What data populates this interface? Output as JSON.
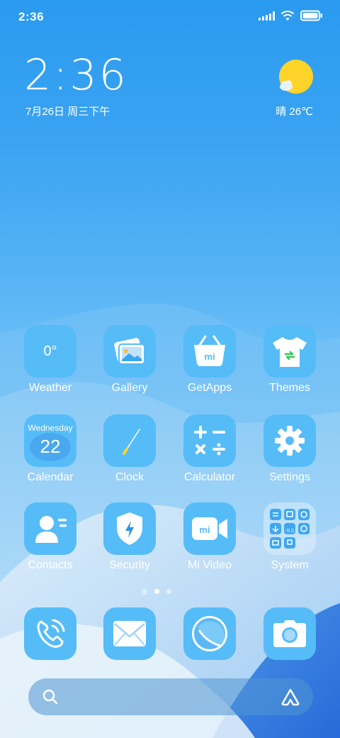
{
  "status_bar": {
    "time": "2:36",
    "icons": [
      "signal-icon",
      "wifi-icon",
      "battery-icon"
    ]
  },
  "clock_widget": {
    "time": "2:36",
    "date": "7月26日 周三下午"
  },
  "weather_widget": {
    "icon": "sunny-partly-cloudy-icon",
    "text": "晴 26℃"
  },
  "apps": [
    {
      "label": "Weather",
      "icon": "weather-icon",
      "tile_text": "0°"
    },
    {
      "label": "Gallery",
      "icon": "gallery-icon"
    },
    {
      "label": "GetApps",
      "icon": "getapps-basket-icon",
      "tile_text": "mi"
    },
    {
      "label": "Themes",
      "icon": "themes-tshirt-icon"
    },
    {
      "label": "Calendar",
      "icon": "calendar-icon",
      "tile_day": "Wednesday",
      "tile_date": "22"
    },
    {
      "label": "Clock",
      "icon": "clock-icon"
    },
    {
      "label": "Calculator",
      "icon": "calculator-icon"
    },
    {
      "label": "Settings",
      "icon": "gear-icon"
    },
    {
      "label": "Contacts",
      "icon": "contacts-icon"
    },
    {
      "label": "Security",
      "icon": "shield-icon"
    },
    {
      "label": "Mi Video",
      "icon": "video-camera-icon",
      "tile_text": "mi"
    },
    {
      "label": "System",
      "icon": "folder-icon"
    }
  ],
  "pages": {
    "count": 3,
    "current": 2
  },
  "dock": [
    {
      "icon": "phone-icon"
    },
    {
      "icon": "mail-icon"
    },
    {
      "icon": "browser-icon"
    },
    {
      "icon": "camera-icon"
    }
  ],
  "search": {
    "icon": "search-icon",
    "assistant_icon": "assistant-icon"
  },
  "colors": {
    "tile": "#55bcf8",
    "accent_yellow": "#ffd42a"
  }
}
